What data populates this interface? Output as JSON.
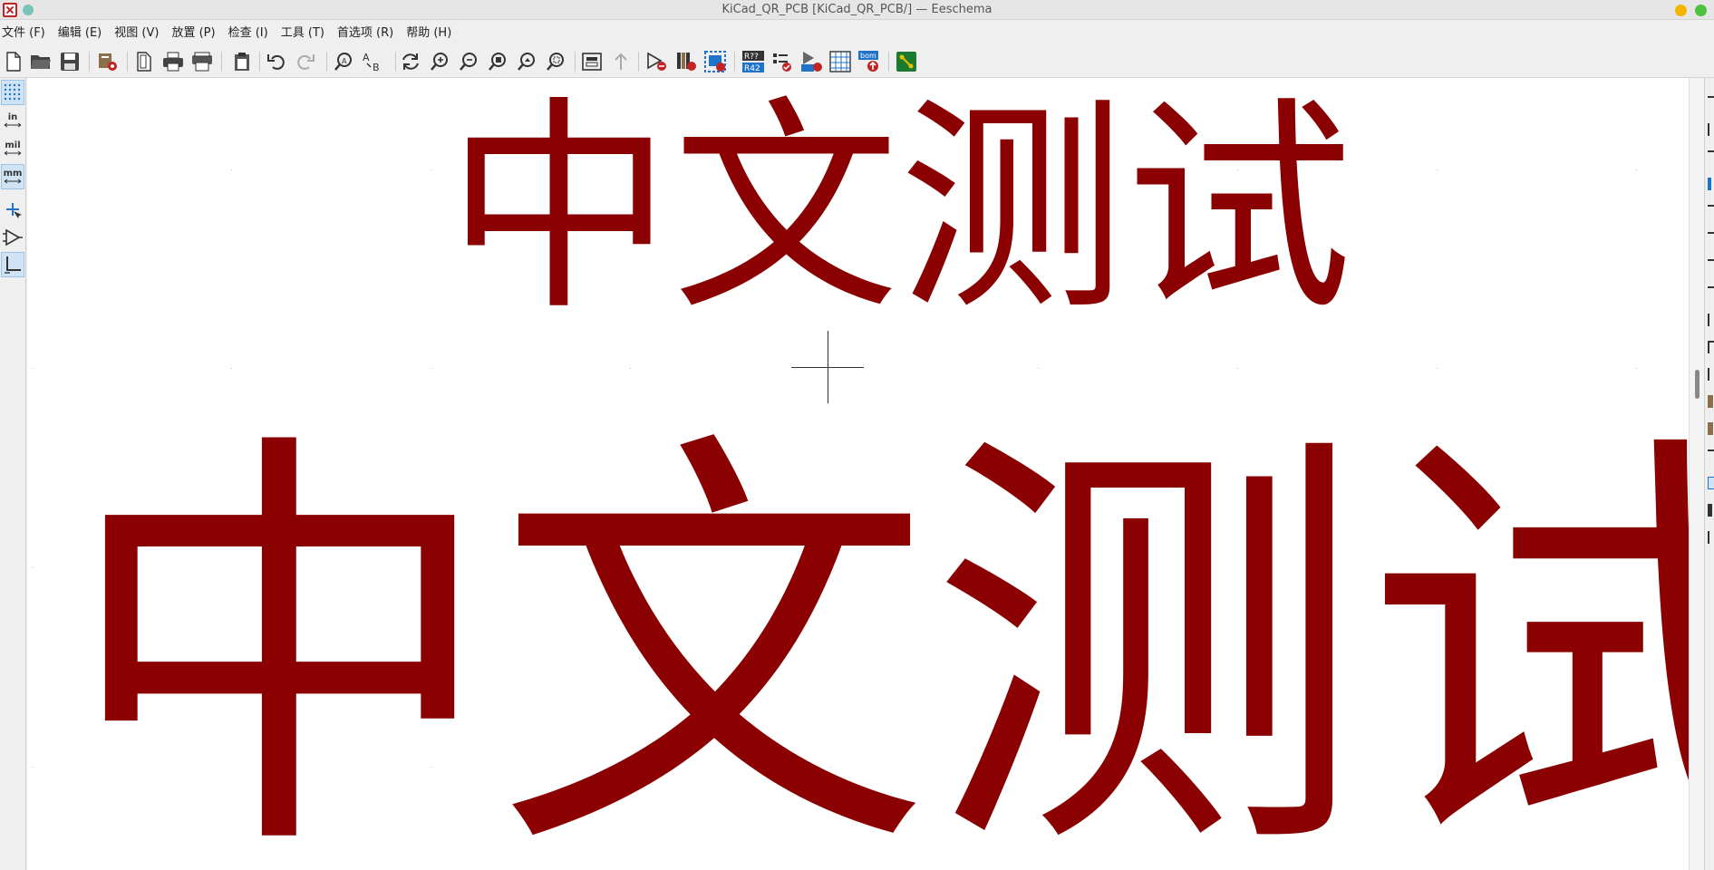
{
  "window": {
    "title": "KiCad_QR_PCB [KiCad_QR_PCB/] — Eeschema"
  },
  "menu": {
    "items": [
      {
        "label": "文件 (F)"
      },
      {
        "label": "编辑 (E)"
      },
      {
        "label": "视图 (V)"
      },
      {
        "label": "放置 (P)"
      },
      {
        "label": "检查 (I)"
      },
      {
        "label": "工具 (T)"
      },
      {
        "label": "首选项 (R)"
      },
      {
        "label": "帮助 (H)"
      }
    ]
  },
  "toolbar": {
    "icons": [
      "new-schematic-icon",
      "open-icon",
      "save-icon",
      "schematic-setup-icon",
      "page-settings-icon",
      "print-icon",
      "plot-icon",
      "paste-icon",
      "undo-icon",
      "redo-icon",
      "find-icon",
      "find-replace-icon",
      "refresh-icon",
      "zoom-in-icon",
      "zoom-out-icon",
      "zoom-fit-icon",
      "zoom-objects-icon",
      "zoom-selection-icon",
      "hierarchy-navigator-icon",
      "leave-sheet-icon",
      "symbol-editor-icon",
      "symbol-browser-icon",
      "update-pcb-icon",
      "annotate-icon",
      "erc-icon",
      "footprint-assign-icon",
      "bom-table-icon",
      "bom-generate-icon",
      "pcb-editor-icon"
    ],
    "annotate_label_top": "R??",
    "annotate_label_bottom": "R42",
    "bom_label": "bom"
  },
  "left_toolbar": {
    "units_in": "in",
    "units_mil": "mil",
    "units_mm": "mm"
  },
  "canvas": {
    "text_small": "中文测试",
    "text_large": "中文测试",
    "text_color": "#8b0000"
  },
  "colors": {
    "accent_red": "#c12424",
    "selection_blue": "#cfe3f5"
  }
}
